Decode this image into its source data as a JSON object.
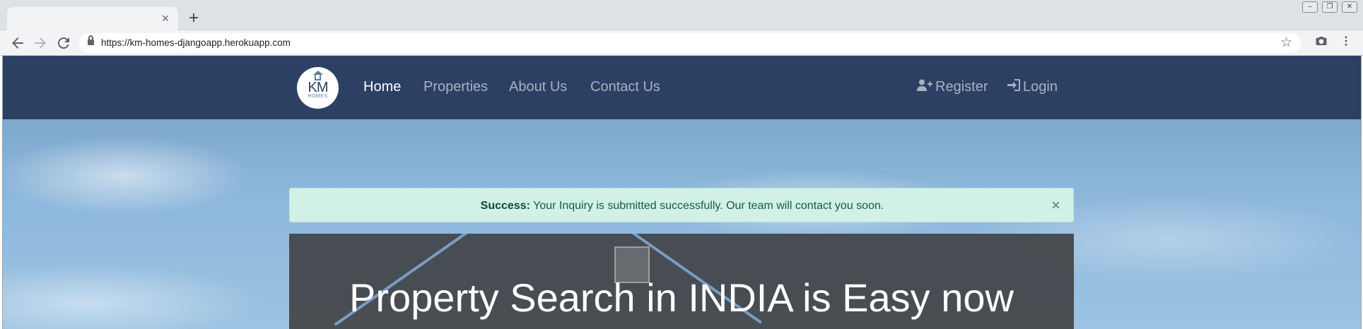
{
  "browser": {
    "tab_title": "",
    "tab_close": "×",
    "new_tab": "+",
    "url": "https://km-homes-djangoapp.herokuapp.com",
    "controls": {
      "minimize": "–",
      "restore": "❐",
      "close": "✕"
    }
  },
  "icons": {
    "back": "back-arrow-icon",
    "forward": "forward-arrow-icon",
    "reload": "reload-icon",
    "lock": "lock-icon",
    "star": "star-icon",
    "camera": "camera-icon",
    "menu": "kebab-menu-icon",
    "register": "user-plus-icon",
    "login": "sign-in-icon",
    "close": "close-icon"
  },
  "site": {
    "logo": {
      "mark": "KM",
      "sub": "HOMES"
    },
    "nav": [
      {
        "label": "Home",
        "active": true
      },
      {
        "label": "Properties",
        "active": false
      },
      {
        "label": "About Us",
        "active": false
      },
      {
        "label": "Contact Us",
        "active": false
      }
    ],
    "auth": {
      "register": "Register",
      "login": "Login"
    }
  },
  "alert": {
    "strong": "Success:",
    "message": "Your Inquiry is submitted successfully. Our team will contact you soon.",
    "close": "×"
  },
  "hero": {
    "title": "Property Search in INDIA is Easy now"
  },
  "colors": {
    "navbar": "#2c4064",
    "alert_bg": "#d1f0e6",
    "alert_text": "#155c43"
  }
}
